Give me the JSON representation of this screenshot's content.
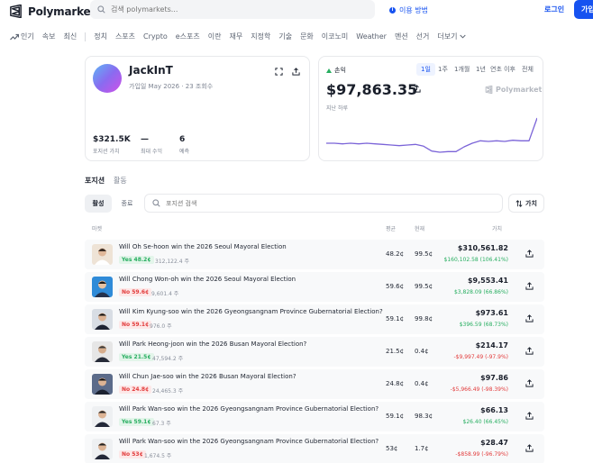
{
  "header": {
    "brand": "Polymarket",
    "search_placeholder": "검색 polymarkets...",
    "how_it_works": "이용 방법",
    "login": "로그인",
    "signup": "가입"
  },
  "nav": {
    "items": [
      "인기",
      "속보",
      "최신",
      "정치",
      "스포츠",
      "Crypto",
      "e스포츠",
      "이란",
      "재무",
      "지정학",
      "기술",
      "문화",
      "이코노미",
      "Weather",
      "멘션",
      "선거"
    ],
    "more": "더보기"
  },
  "profile": {
    "name": "JackInT",
    "joined": "가입일 May 2026",
    "views": "23 조회수",
    "stats": [
      {
        "value": "$321.5K",
        "label": "포지션 가치"
      },
      {
        "value": "—",
        "label": "최대 수익"
      },
      {
        "value": "6",
        "label": "예측"
      }
    ]
  },
  "pnl": {
    "label": "손익",
    "value": "$97,863.35",
    "period": "지난 하루",
    "watermark": "Polymarket",
    "ranges": [
      "1일",
      "1주",
      "1개월",
      "1년",
      "연초 이후",
      "전체"
    ],
    "active_range": "1일",
    "accent_color": "#27ae60",
    "chart_color": "#7b64d8"
  },
  "chart_data": {
    "type": "line",
    "y": [
      0.58,
      0.58,
      0.57,
      0.58,
      0.57,
      0.58,
      0.57,
      0.56,
      0.55,
      0.54,
      0.55,
      0.56,
      0.53,
      0.45,
      0.43,
      0.44,
      0.44,
      0.52,
      0.58,
      0.62,
      0.61,
      0.62,
      0.61,
      0.63,
      0.62,
      0.62,
      1.0
    ],
    "title": "",
    "xlabel": "",
    "ylabel": ""
  },
  "tabs": {
    "positions": "포지션",
    "activity": "활동"
  },
  "filters": {
    "active": "활성",
    "closed": "종료"
  },
  "position_search_placeholder": "포지션 검색",
  "sort_label": "가치",
  "columns": {
    "market": "마켓",
    "avg": "평균",
    "current": "현재",
    "value": "가치"
  },
  "positions": [
    {
      "title": "Will Oh Se-hoon win the 2026 Seoul Mayoral Election",
      "outcome": "Yes 48.2¢",
      "side": "yes",
      "shares": "312,122.4 주",
      "avg": "48.2¢",
      "current": "99.5¢",
      "value": "$310,561.82",
      "pnl": "$160,102.58 (106.41%)",
      "pnl_sign": "pos"
    },
    {
      "title": "Will Chong Won-oh win the 2026 Seoul Mayoral Election",
      "outcome": "No 59.6¢",
      "side": "no",
      "shares": "9,601.4 주",
      "avg": "59.6¢",
      "current": "99.5¢",
      "value": "$9,553.41",
      "pnl": "$3,828.09 (66.86%)",
      "pnl_sign": "pos"
    },
    {
      "title": "Will Kim Kyung-soo win the 2026 Gyeongsangnam Province Gubernatorial Election?",
      "outcome": "No 59.1¢",
      "side": "no",
      "shares": "976.0 주",
      "avg": "59.1¢",
      "current": "99.8¢",
      "value": "$973.61",
      "pnl": "$396.59 (68.73%)",
      "pnl_sign": "pos"
    },
    {
      "title": "Will Park Heong-joon win the 2026 Busan Mayoral Election?",
      "outcome": "Yes 21.5¢",
      "side": "yes",
      "shares": "47,594.2 주",
      "avg": "21.5¢",
      "current": "0.4¢",
      "value": "$214.17",
      "pnl": "-$9,997.49 (-97.9%)",
      "pnl_sign": "neg"
    },
    {
      "title": "Will Chun Jae-soo win the 2026 Busan Mayoral Election?",
      "outcome": "No 24.8¢",
      "side": "no",
      "shares": "24,465.3 주",
      "avg": "24.8¢",
      "current": "0.4¢",
      "value": "$97.86",
      "pnl": "-$5,966.49 (-98.39%)",
      "pnl_sign": "neg"
    },
    {
      "title": "Will Park Wan-soo win the 2026 Gyeongsangnam Province Gubernatorial Election?",
      "outcome": "Yes 59.1¢",
      "side": "yes",
      "shares": "67.3 주",
      "avg": "59.1¢",
      "current": "98.3¢",
      "value": "$66.13",
      "pnl": "$26.40 (66.45%)",
      "pnl_sign": "pos"
    },
    {
      "title": "Will Park Wan-soo win the 2026 Gyeongsangnam Province Gubernatorial Election?",
      "outcome": "No 53¢",
      "side": "no",
      "shares": "1,674.5 주",
      "avg": "53¢",
      "current": "1.7¢",
      "value": "$28.47",
      "pnl": "-$858.99 (-96.79%)",
      "pnl_sign": "neg"
    }
  ]
}
